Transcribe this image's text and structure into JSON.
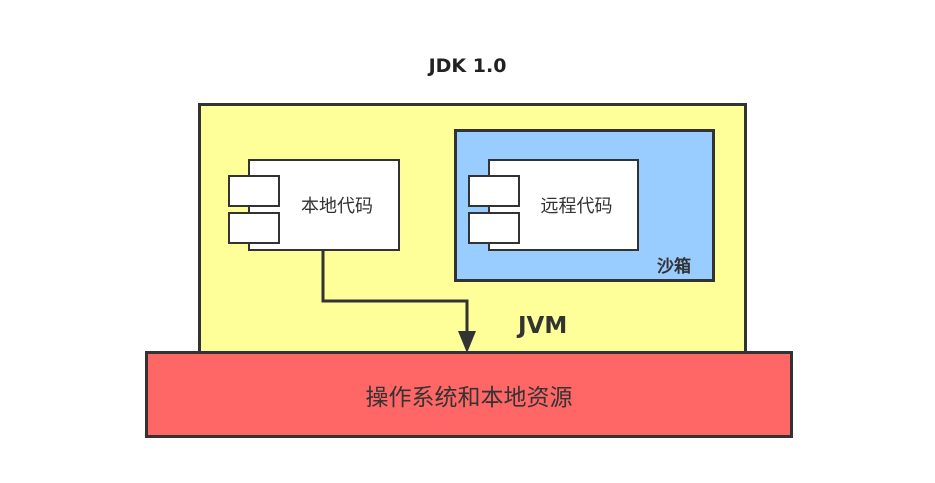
{
  "title": "JDK 1.0",
  "jvm": {
    "label": "JVM"
  },
  "sandbox": {
    "label": "沙箱"
  },
  "local_code": {
    "label": "本地代码"
  },
  "remote_code": {
    "label": "远程代码"
  },
  "os_resources": {
    "label": "操作系统和本地资源"
  },
  "colors": {
    "jvm_fill": "#ffff99",
    "sandbox_fill": "#99ccff",
    "os_fill": "#ff6666",
    "component_fill": "#ffffff",
    "stroke": "#333333"
  }
}
